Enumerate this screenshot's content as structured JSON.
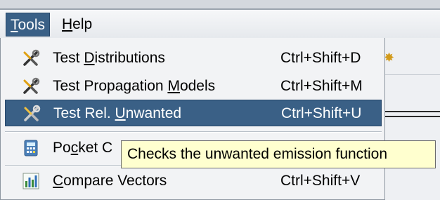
{
  "menubar": {
    "items": [
      {
        "pre": "",
        "mn": "T",
        "post": "ools"
      },
      {
        "pre": "",
        "mn": "H",
        "post": "elp"
      }
    ]
  },
  "tools_menu": {
    "items": [
      {
        "pre": "Test ",
        "mn": "D",
        "post": "istributions",
        "accel": "Ctrl+Shift+D",
        "icon": "tools-icon"
      },
      {
        "pre": "Test Propagation ",
        "mn": "M",
        "post": "odels",
        "accel": "Ctrl+Shift+M",
        "icon": "tools-icon"
      },
      {
        "pre": "Test Rel. ",
        "mn": "U",
        "post": "nwanted",
        "accel": "Ctrl+Shift+U",
        "icon": "tools-icon"
      },
      {
        "pre": "Po",
        "mn": "c",
        "post": "ket C",
        "accel": "",
        "icon": "calculator-icon"
      },
      {
        "pre": "",
        "mn": "C",
        "post": "ompare Vectors",
        "accel": "Ctrl+Shift+V",
        "icon": "chart-icon"
      }
    ]
  },
  "tooltip": {
    "text": "Checks the unwanted emission function"
  },
  "colors": {
    "highlight": "#3a6086",
    "tooltip_bg": "#ffffcf"
  }
}
